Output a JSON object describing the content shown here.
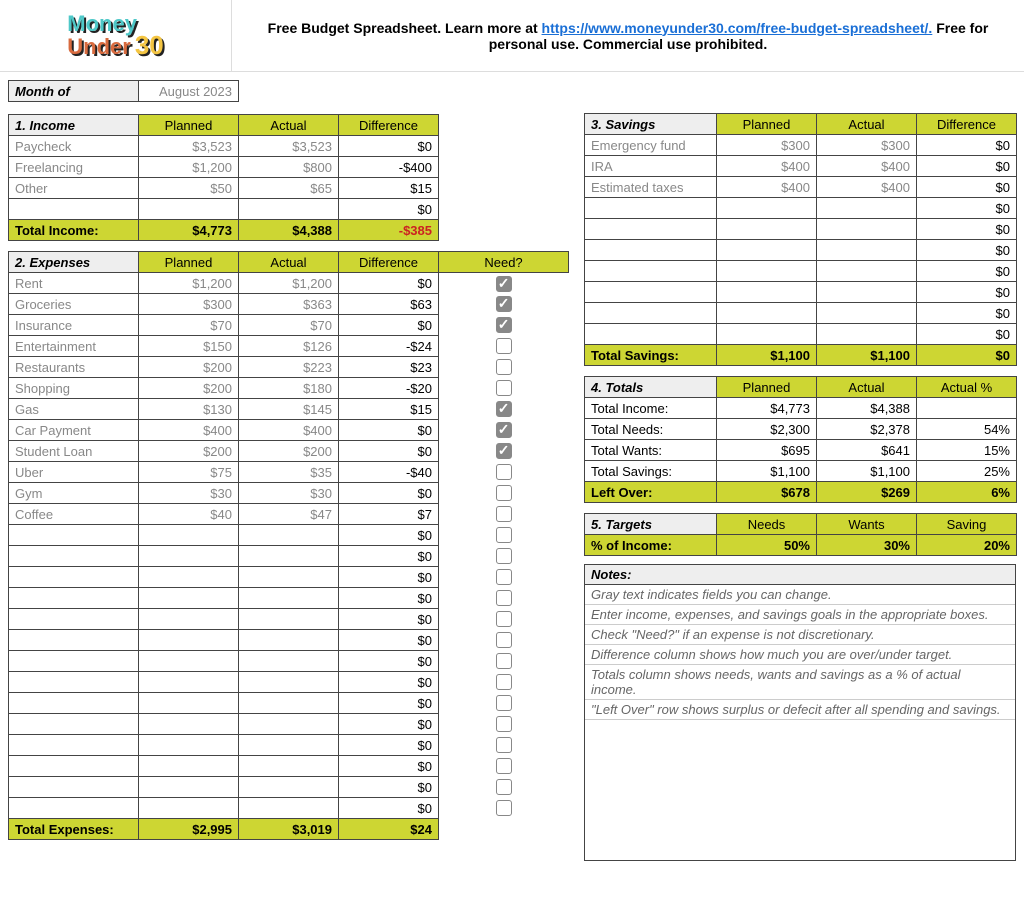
{
  "header": {
    "logo_l1": "Money",
    "logo_l2": "Under",
    "logo_l3": "30",
    "text_before": "Free Budget Spreadsheet. Learn more at ",
    "link_text": "https://www.moneyunder30.com/free-budget-spreadsheet/.",
    "link_href": "https://www.moneyunder30.com/free-budget-spreadsheet/",
    "text_after": " Free for personal use. Commercial use prohibited."
  },
  "month": {
    "label": "Month of",
    "value": "August 2023"
  },
  "col_headers": {
    "planned": "Planned",
    "actual": "Actual",
    "difference": "Difference",
    "need": "Need?"
  },
  "income": {
    "title": "1. Income",
    "rows": [
      {
        "label": "Paycheck",
        "planned": "$3,523",
        "actual": "$3,523",
        "diff": "$0"
      },
      {
        "label": "Freelancing",
        "planned": "$1,200",
        "actual": "$800",
        "diff": "-$400"
      },
      {
        "label": "Other",
        "planned": "$50",
        "actual": "$65",
        "diff": "$15"
      },
      {
        "label": "",
        "planned": "",
        "actual": "",
        "diff": "$0"
      }
    ],
    "total": {
      "label": "Total Income:",
      "planned": "$4,773",
      "actual": "$4,388",
      "diff": "-$385"
    }
  },
  "expenses": {
    "title": "2. Expenses",
    "rows": [
      {
        "label": "Rent",
        "planned": "$1,200",
        "actual": "$1,200",
        "diff": "$0",
        "need": true
      },
      {
        "label": "Groceries",
        "planned": "$300",
        "actual": "$363",
        "diff": "$63",
        "need": true
      },
      {
        "label": "Insurance",
        "planned": "$70",
        "actual": "$70",
        "diff": "$0",
        "need": true
      },
      {
        "label": "Entertainment",
        "planned": "$150",
        "actual": "$126",
        "diff": "-$24",
        "need": false
      },
      {
        "label": "Restaurants",
        "planned": "$200",
        "actual": "$223",
        "diff": "$23",
        "need": false
      },
      {
        "label": "Shopping",
        "planned": "$200",
        "actual": "$180",
        "diff": "-$20",
        "need": false
      },
      {
        "label": "Gas",
        "planned": "$130",
        "actual": "$145",
        "diff": "$15",
        "need": true
      },
      {
        "label": "Car Payment",
        "planned": "$400",
        "actual": "$400",
        "diff": "$0",
        "need": true
      },
      {
        "label": "Student Loan",
        "planned": "$200",
        "actual": "$200",
        "diff": "$0",
        "need": true
      },
      {
        "label": "Uber",
        "planned": "$75",
        "actual": "$35",
        "diff": "-$40",
        "need": false
      },
      {
        "label": "Gym",
        "planned": "$30",
        "actual": "$30",
        "diff": "$0",
        "need": false
      },
      {
        "label": "Coffee",
        "planned": "$40",
        "actual": "$47",
        "diff": "$7",
        "need": false
      },
      {
        "label": "",
        "planned": "",
        "actual": "",
        "diff": "$0",
        "need": false
      },
      {
        "label": "",
        "planned": "",
        "actual": "",
        "diff": "$0",
        "need": false
      },
      {
        "label": "",
        "planned": "",
        "actual": "",
        "diff": "$0",
        "need": false
      },
      {
        "label": "",
        "planned": "",
        "actual": "",
        "diff": "$0",
        "need": false
      },
      {
        "label": "",
        "planned": "",
        "actual": "",
        "diff": "$0",
        "need": false
      },
      {
        "label": "",
        "planned": "",
        "actual": "",
        "diff": "$0",
        "need": false
      },
      {
        "label": "",
        "planned": "",
        "actual": "",
        "diff": "$0",
        "need": false
      },
      {
        "label": "",
        "planned": "",
        "actual": "",
        "diff": "$0",
        "need": false
      },
      {
        "label": "",
        "planned": "",
        "actual": "",
        "diff": "$0",
        "need": false
      },
      {
        "label": "",
        "planned": "",
        "actual": "",
        "diff": "$0",
        "need": false
      },
      {
        "label": "",
        "planned": "",
        "actual": "",
        "diff": "$0",
        "need": false
      },
      {
        "label": "",
        "planned": "",
        "actual": "",
        "diff": "$0",
        "need": false
      },
      {
        "label": "",
        "planned": "",
        "actual": "",
        "diff": "$0",
        "need": false
      },
      {
        "label": "",
        "planned": "",
        "actual": "",
        "diff": "$0",
        "need": false
      }
    ],
    "total": {
      "label": "Total Expenses:",
      "planned": "$2,995",
      "actual": "$3,019",
      "diff": "$24"
    }
  },
  "savings": {
    "title": "3. Savings",
    "rows": [
      {
        "label": "Emergency fund",
        "planned": "$300",
        "actual": "$300",
        "diff": "$0"
      },
      {
        "label": "IRA",
        "planned": "$400",
        "actual": "$400",
        "diff": "$0"
      },
      {
        "label": "Estimated taxes",
        "planned": "$400",
        "actual": "$400",
        "diff": "$0"
      },
      {
        "label": "",
        "planned": "",
        "actual": "",
        "diff": "$0"
      },
      {
        "label": "",
        "planned": "",
        "actual": "",
        "diff": "$0"
      },
      {
        "label": "",
        "planned": "",
        "actual": "",
        "diff": "$0"
      },
      {
        "label": "",
        "planned": "",
        "actual": "",
        "diff": "$0"
      },
      {
        "label": "",
        "planned": "",
        "actual": "",
        "diff": "$0"
      },
      {
        "label": "",
        "planned": "",
        "actual": "",
        "diff": "$0"
      },
      {
        "label": "",
        "planned": "",
        "actual": "",
        "diff": "$0"
      }
    ],
    "total": {
      "label": "Total Savings:",
      "planned": "$1,100",
      "actual": "$1,100",
      "diff": "$0"
    }
  },
  "totals": {
    "title": "4. Totals",
    "headers": {
      "planned": "Planned",
      "actual": "Actual",
      "pct": "Actual %"
    },
    "rows": [
      {
        "label": "Total Income:",
        "planned": "$4,773",
        "actual": "$4,388",
        "pct": ""
      },
      {
        "label": "Total Needs:",
        "planned": "$2,300",
        "actual": "$2,378",
        "pct": "54%"
      },
      {
        "label": "Total Wants:",
        "planned": "$695",
        "actual": "$641",
        "pct": "15%"
      },
      {
        "label": "Total Savings:",
        "planned": "$1,100",
        "actual": "$1,100",
        "pct": "25%"
      }
    ],
    "leftover": {
      "label": "Left Over:",
      "planned": "$678",
      "actual": "$269",
      "pct": "6%"
    }
  },
  "targets": {
    "title": "5. Targets",
    "headers": {
      "needs": "Needs",
      "wants": "Wants",
      "saving": "Saving"
    },
    "row": {
      "label": "% of Income:",
      "needs": "50%",
      "wants": "30%",
      "saving": "20%"
    }
  },
  "notes": {
    "title": "Notes:",
    "lines": [
      "Gray text indicates fields you can change.",
      "Enter income, expenses, and savings goals in the appropriate boxes.",
      "Check \"Need?\" if an expense is not discretionary.",
      "Difference column shows how much you are over/under target.",
      "Totals column shows needs, wants and savings as a % of actual income.",
      "\"Left Over\" row shows surplus or defecit after all spending and savings."
    ]
  }
}
